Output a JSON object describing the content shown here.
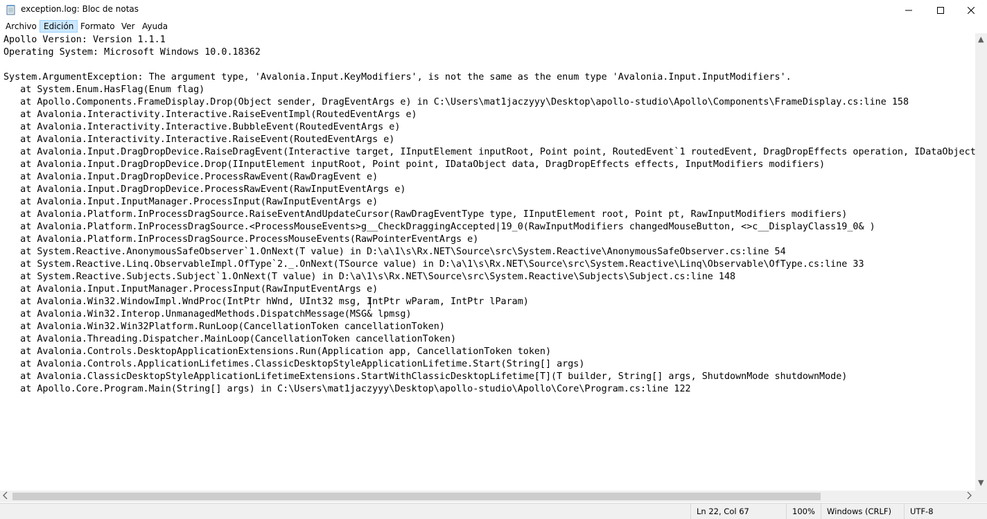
{
  "window": {
    "title": "exception.log: Bloc de notas",
    "controls": {
      "minimize": "minimize-icon",
      "maximize": "maximize-icon",
      "close": "close-icon"
    }
  },
  "menu": {
    "items": [
      {
        "label": "Archivo",
        "active": false
      },
      {
        "label": "Edición",
        "active": true
      },
      {
        "label": "Formato",
        "active": false
      },
      {
        "label": "Ver",
        "active": false
      },
      {
        "label": "Ayuda",
        "active": false
      }
    ]
  },
  "document": {
    "lines": [
      "Apollo Version: Version 1.1.1",
      "Operating System: Microsoft Windows 10.0.18362",
      "",
      "System.ArgumentException: The argument type, 'Avalonia.Input.KeyModifiers', is not the same as the enum type 'Avalonia.Input.InputModifiers'.",
      "   at System.Enum.HasFlag(Enum flag)",
      "   at Apollo.Components.FrameDisplay.Drop(Object sender, DragEventArgs e) in C:\\Users\\mat1jaczyyy\\Desktop\\apollo-studio\\Apollo\\Components\\FrameDisplay.cs:line 158",
      "   at Avalonia.Interactivity.Interactive.RaiseEventImpl(RoutedEventArgs e)",
      "   at Avalonia.Interactivity.Interactive.BubbleEvent(RoutedEventArgs e)",
      "   at Avalonia.Interactivity.Interactive.RaiseEvent(RoutedEventArgs e)",
      "   at Avalonia.Input.DragDropDevice.RaiseDragEvent(Interactive target, IInputElement inputRoot, Point point, RoutedEvent`1 routedEvent, DragDropEffects operation, IDataObject",
      "   at Avalonia.Input.DragDropDevice.Drop(IInputElement inputRoot, Point point, IDataObject data, DragDropEffects effects, InputModifiers modifiers)",
      "   at Avalonia.Input.DragDropDevice.ProcessRawEvent(RawDragEvent e)",
      "   at Avalonia.Input.DragDropDevice.ProcessRawEvent(RawInputEventArgs e)",
      "   at Avalonia.Input.InputManager.ProcessInput(RawInputEventArgs e)",
      "   at Avalonia.Platform.InProcessDragSource.RaiseEventAndUpdateCursor(RawDragEventType type, IInputElement root, Point pt, RawInputModifiers modifiers)",
      "   at Avalonia.Platform.InProcessDragSource.<ProcessMouseEvents>g__CheckDraggingAccepted|19_0(RawInputModifiers changedMouseButton, <>c__DisplayClass19_0& )",
      "   at Avalonia.Platform.InProcessDragSource.ProcessMouseEvents(RawPointerEventArgs e)",
      "   at System.Reactive.AnonymousSafeObserver`1.OnNext(T value) in D:\\a\\1\\s\\Rx.NET\\Source\\src\\System.Reactive\\AnonymousSafeObserver.cs:line 54",
      "   at System.Reactive.Linq.ObservableImpl.OfType`2._.OnNext(TSource value) in D:\\a\\1\\s\\Rx.NET\\Source\\src\\System.Reactive\\Linq\\Observable\\OfType.cs:line 33",
      "   at System.Reactive.Subjects.Subject`1.OnNext(T value) in D:\\a\\1\\s\\Rx.NET\\Source\\src\\System.Reactive\\Subjects\\Subject.cs:line 148",
      "   at Avalonia.Input.InputManager.ProcessInput(RawInputEventArgs e)",
      "   at Avalonia.Win32.WindowImpl.WndProc(IntPtr hWnd, UInt32 msg, IntPtr wParam, IntPtr lParam)",
      "   at Avalonia.Win32.Interop.UnmanagedMethods.DispatchMessage(MSG& lpmsg)",
      "   at Avalonia.Win32.Win32Platform.RunLoop(CancellationToken cancellationToken)",
      "   at Avalonia.Threading.Dispatcher.MainLoop(CancellationToken cancellationToken)",
      "   at Avalonia.Controls.DesktopApplicationExtensions.Run(Application app, CancellationToken token)",
      "   at Avalonia.Controls.ApplicationLifetimes.ClassicDesktopStyleApplicationLifetime.Start(String[] args)",
      "   at Avalonia.ClassicDesktopStyleApplicationLifetimeExtensions.StartWithClassicDesktopLifetime[T](T builder, String[] args, ShutdownMode shutdownMode)",
      "   at Apollo.Core.Program.Main(String[] args) in C:\\Users\\mat1jaczyyy\\Desktop\\apollo-studio\\Apollo\\Core\\Program.cs:line 122"
    ]
  },
  "statusbar": {
    "position": "Ln 22, Col 67",
    "zoom": "100%",
    "line_endings": "Windows (CRLF)",
    "encoding": "UTF-8"
  },
  "scrollbars": {
    "left_arrow": "scroll-left-icon",
    "right_arrow": "scroll-right-icon"
  }
}
